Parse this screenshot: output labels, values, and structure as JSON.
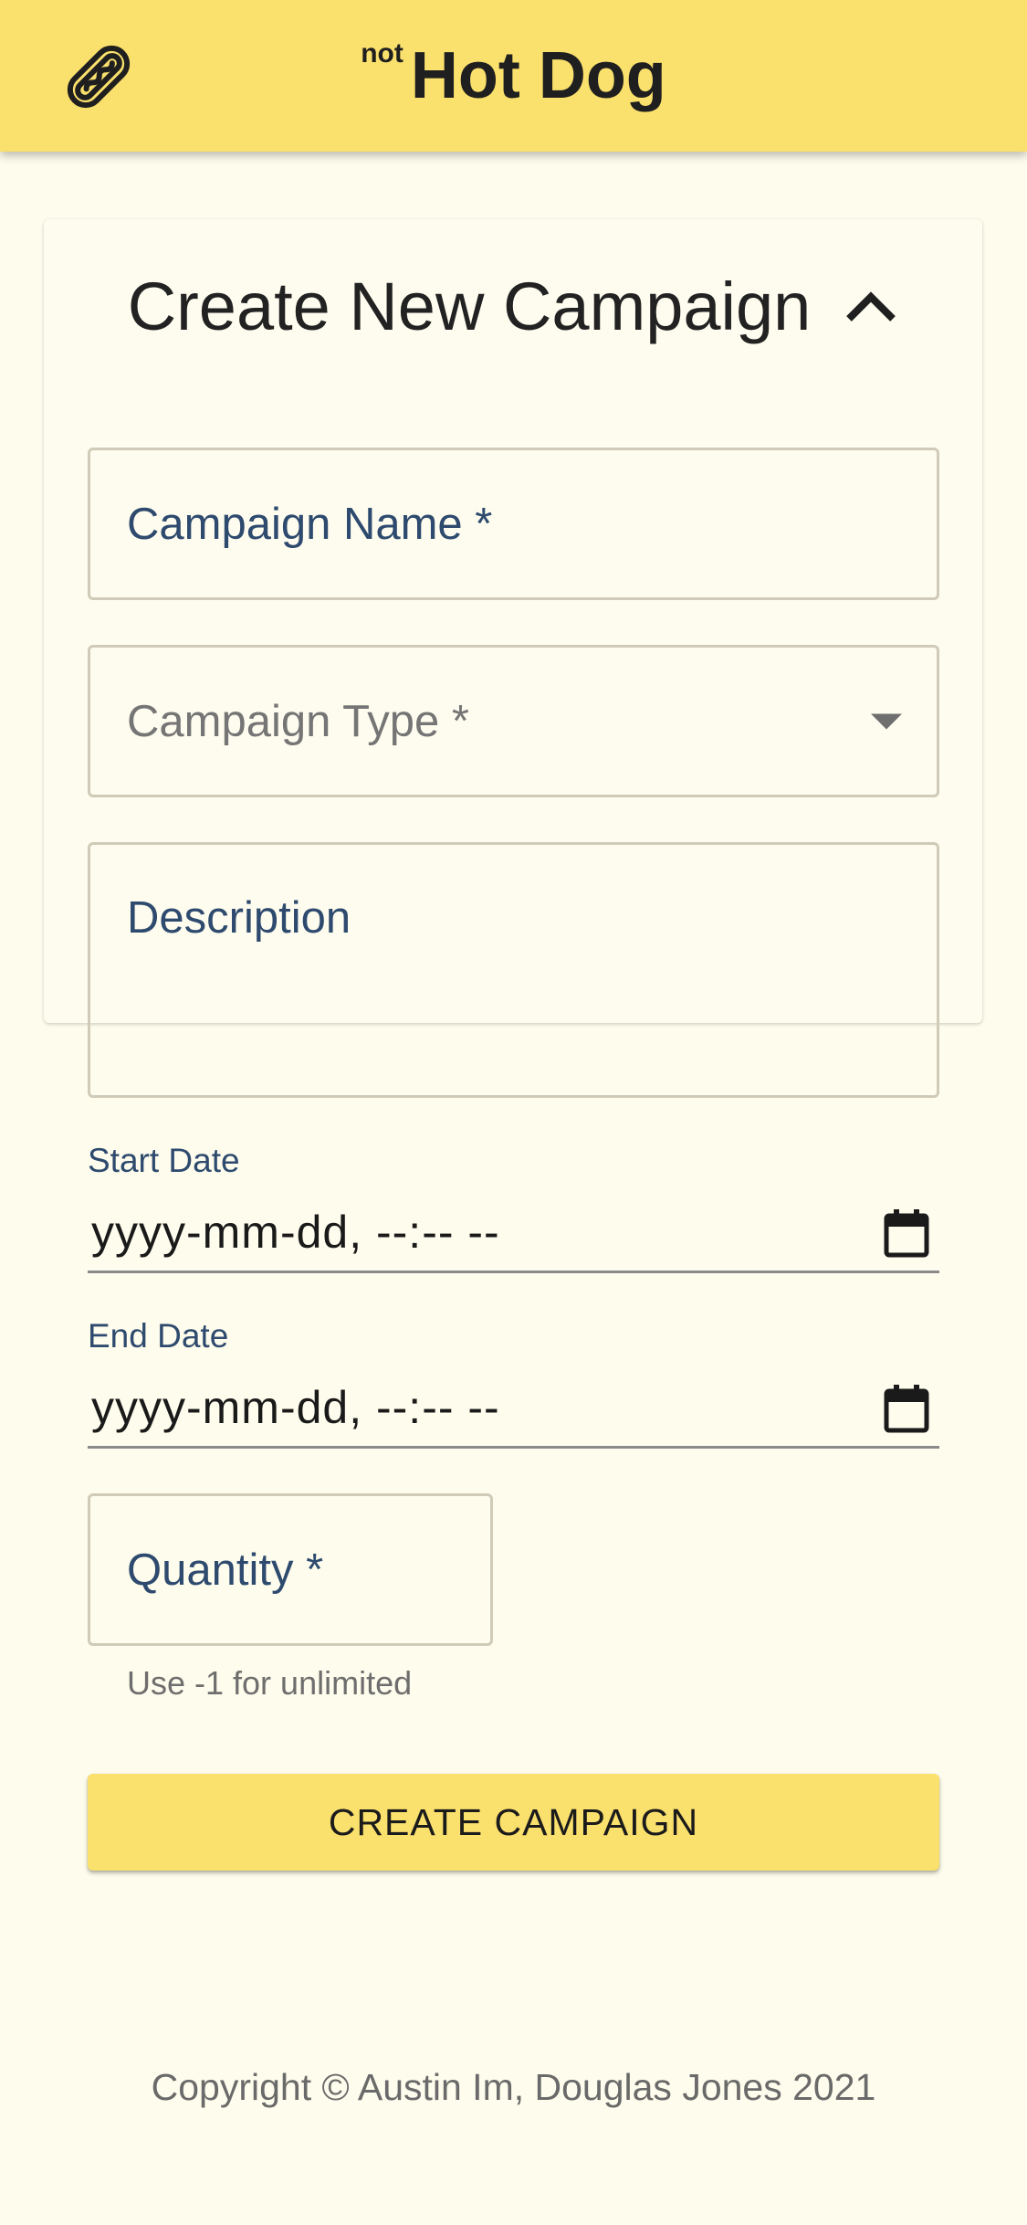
{
  "header": {
    "brand_prefix": "not",
    "brand_name": "Hot Dog",
    "menu_icon": "hot-dog-icon",
    "background_color": "#fae06c"
  },
  "form": {
    "title": "Create New Campaign",
    "collapse_icon": "chevron-up-icon",
    "campaign_name_label": "Campaign Name *",
    "campaign_type_label": "Campaign Type *",
    "description_label": "Description",
    "start_date_label": "Start Date",
    "start_date_value": "yyyy-mm-dd, --:-- --",
    "end_date_label": "End Date",
    "end_date_value": "yyyy-mm-dd, --:-- --",
    "quantity_label": "Quantity *",
    "quantity_helper": "Use -1 for unlimited",
    "submit_label": "CREATE CAMPAIGN",
    "label_color": "#2e4a6e"
  },
  "footer": {
    "copyright": "Copyright © Austin Im, Douglas Jones 2021"
  }
}
